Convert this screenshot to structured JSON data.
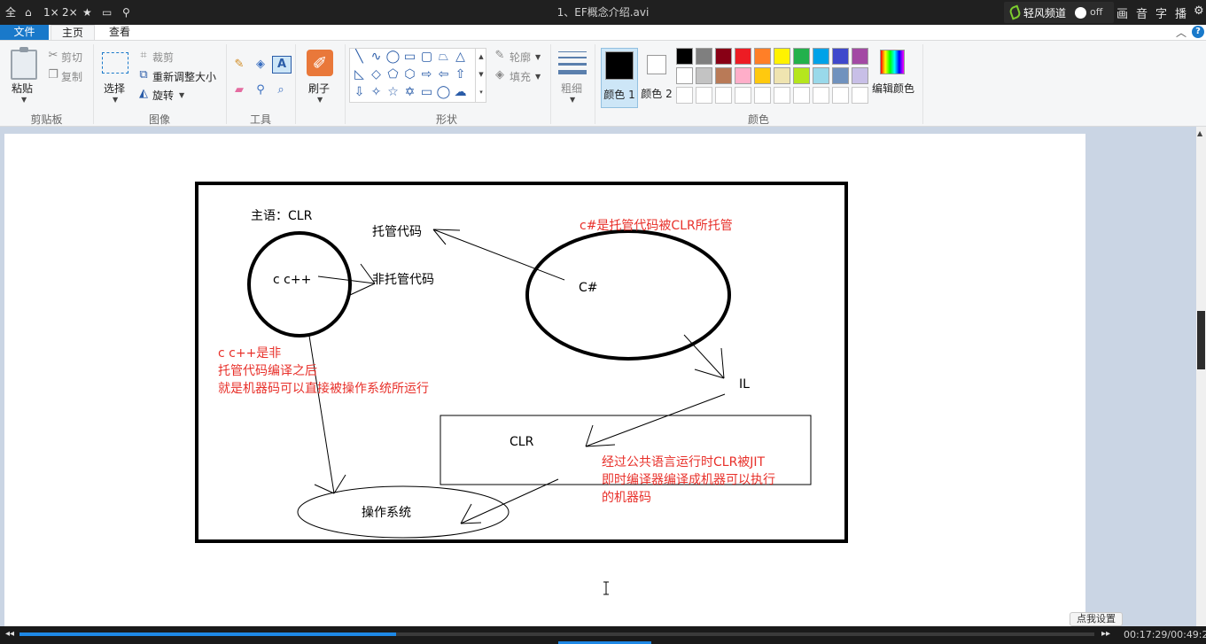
{
  "player": {
    "title": "1、EF概念介绍.avi",
    "left_controls": [
      "全",
      "⌂",
      "1×",
      "2×",
      "★",
      "▭",
      "⚲"
    ],
    "channel_label": "轻风频道",
    "channel_toggle": "off",
    "right_controls": [
      "画",
      "音",
      "字",
      "播",
      "⚙"
    ],
    "time": "00:17:29/00:49:21",
    "progress": 0.35,
    "tip_button": "点我设置"
  },
  "tabs": {
    "file": "文件",
    "home": "主页",
    "view": "查看"
  },
  "ribbon": {
    "clipboard": {
      "group": "剪贴板",
      "paste": "粘贴",
      "cut": "剪切",
      "copy": "复制"
    },
    "image": {
      "group": "图像",
      "select": "选择",
      "crop": "裁剪",
      "resize": "重新调整大小",
      "rotate": "旋转"
    },
    "tools": {
      "group": "工具"
    },
    "brush": {
      "label": "刷子"
    },
    "shapes": {
      "group": "形状",
      "outline": "轮廓",
      "fill": "填充"
    },
    "size": {
      "label": "粗细"
    },
    "colors": {
      "group": "颜色",
      "color1": "颜色 1",
      "color2": "颜色 2",
      "edit": "编辑颜色",
      "color1_value": "#000000",
      "color2_value": "#ffffff",
      "palette_row1": [
        "#000000",
        "#7f7f7f",
        "#880015",
        "#ed1c24",
        "#ff7f27",
        "#fff200",
        "#22b14c",
        "#00a2e8",
        "#3f48cc",
        "#a349a4"
      ],
      "palette_row2": [
        "#ffffff",
        "#c3c3c3",
        "#b97a57",
        "#ffaec9",
        "#ffc90e",
        "#efe4b0",
        "#b5e61d",
        "#99d9ea",
        "#7092be",
        "#c8bfe7"
      ]
    }
  },
  "canvas": {
    "subject": "主语：CLR",
    "cpp_label": "c c++",
    "managed": "托管代码",
    "unmanaged": "非托管代码",
    "csharp_note": "c#是托管代码被CLR所托管",
    "csharp": "C#",
    "cpp_note": [
      "c c++是非",
      "托管代码编译之后",
      "就是机器码可以直接被操作系统所运行"
    ],
    "il": "IL",
    "clr": "CLR",
    "clr_note": [
      "经过公共语言运行时CLR被JIT",
      "即时编译器编译成机器可以执行",
      "的机器码"
    ],
    "os": "操作系统",
    "note_color": "#e8302a"
  }
}
